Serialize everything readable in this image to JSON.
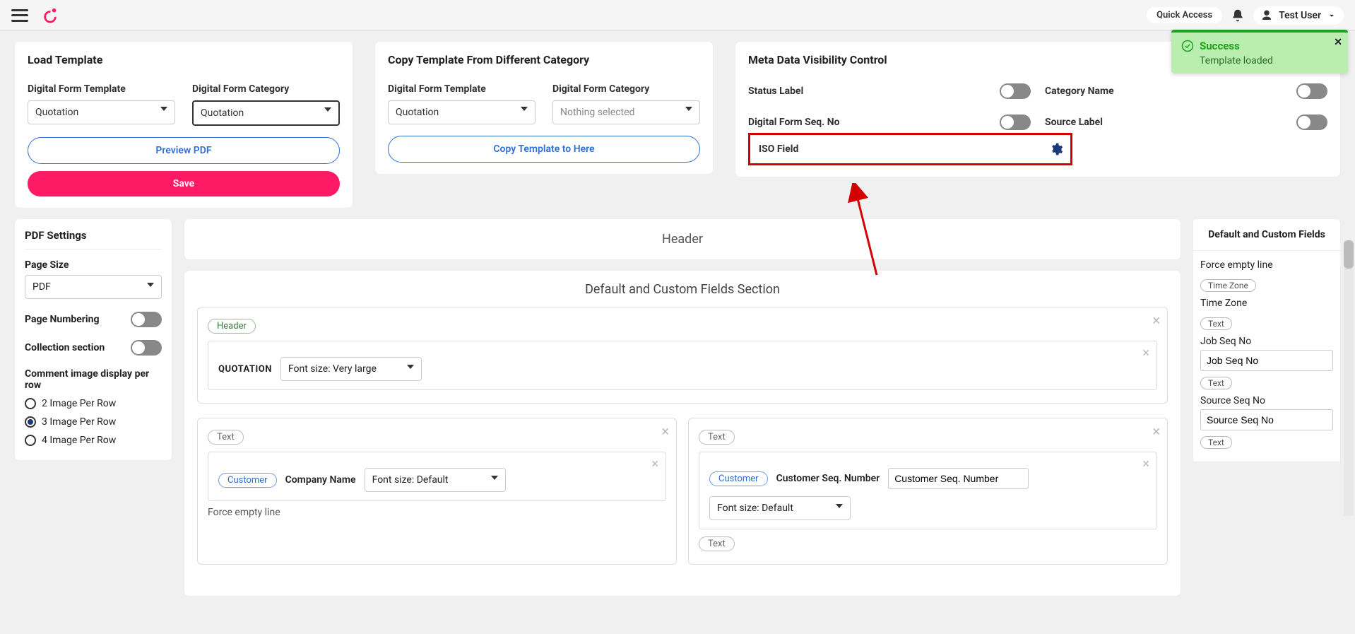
{
  "topbar": {
    "quick_access": "Quick Access",
    "user_name": "Test User"
  },
  "toast": {
    "title": "Success",
    "message": "Template loaded"
  },
  "load_template": {
    "title": "Load Template",
    "template_label": "Digital Form Template",
    "template_value": "Quotation",
    "category_label": "Digital Form Category",
    "category_value": "Quotation",
    "preview_btn": "Preview PDF",
    "save_btn": "Save"
  },
  "copy_template": {
    "title": "Copy Template From Different Category",
    "template_label": "Digital Form Template",
    "template_value": "Quotation",
    "category_label": "Digital Form Category",
    "category_placeholder": "Nothing selected",
    "copy_btn": "Copy Template to Here"
  },
  "meta": {
    "title": "Meta Data Visibility Control",
    "status_label": "Status Label",
    "category_name": "Category Name",
    "seq_no": "Digital Form Seq. No",
    "source_label": "Source Label",
    "iso_field": "ISO Field"
  },
  "pdf_settings": {
    "title": "PDF Settings",
    "page_size_label": "Page Size",
    "page_size_value": "PDF",
    "page_numbering": "Page Numbering",
    "collection_section": "Collection section",
    "comment_display": "Comment image display per row",
    "radios": [
      "2 Image Per Row",
      "3 Image Per Row",
      "4 Image Per Row"
    ],
    "radio_selected": 1
  },
  "header_panel": "Header",
  "section": {
    "title": "Default and Custom Fields Section",
    "header_tag": "Header",
    "quotation_label": "QUOTATION",
    "font_very_large": "Font size: Very large",
    "text_tag": "Text",
    "customer_tag": "Customer",
    "company_name": "Company Name",
    "font_default": "Font size: Default",
    "customer_seq_label": "Customer Seq. Number",
    "customer_seq_value": "Customer Seq. Number",
    "force_empty": "Force empty line"
  },
  "right_panel": {
    "title": "Default and Custom Fields",
    "force_empty": "Force empty line",
    "items": [
      {
        "tag": "Time Zone",
        "label": "Time Zone",
        "input": null
      },
      {
        "tag": "Text",
        "label": "Job Seq No",
        "input": "Job Seq No"
      },
      {
        "tag": "Text",
        "label": "Source Seq No",
        "input": "Source Seq No"
      },
      {
        "tag": "Text",
        "label": "",
        "input": null
      }
    ]
  }
}
